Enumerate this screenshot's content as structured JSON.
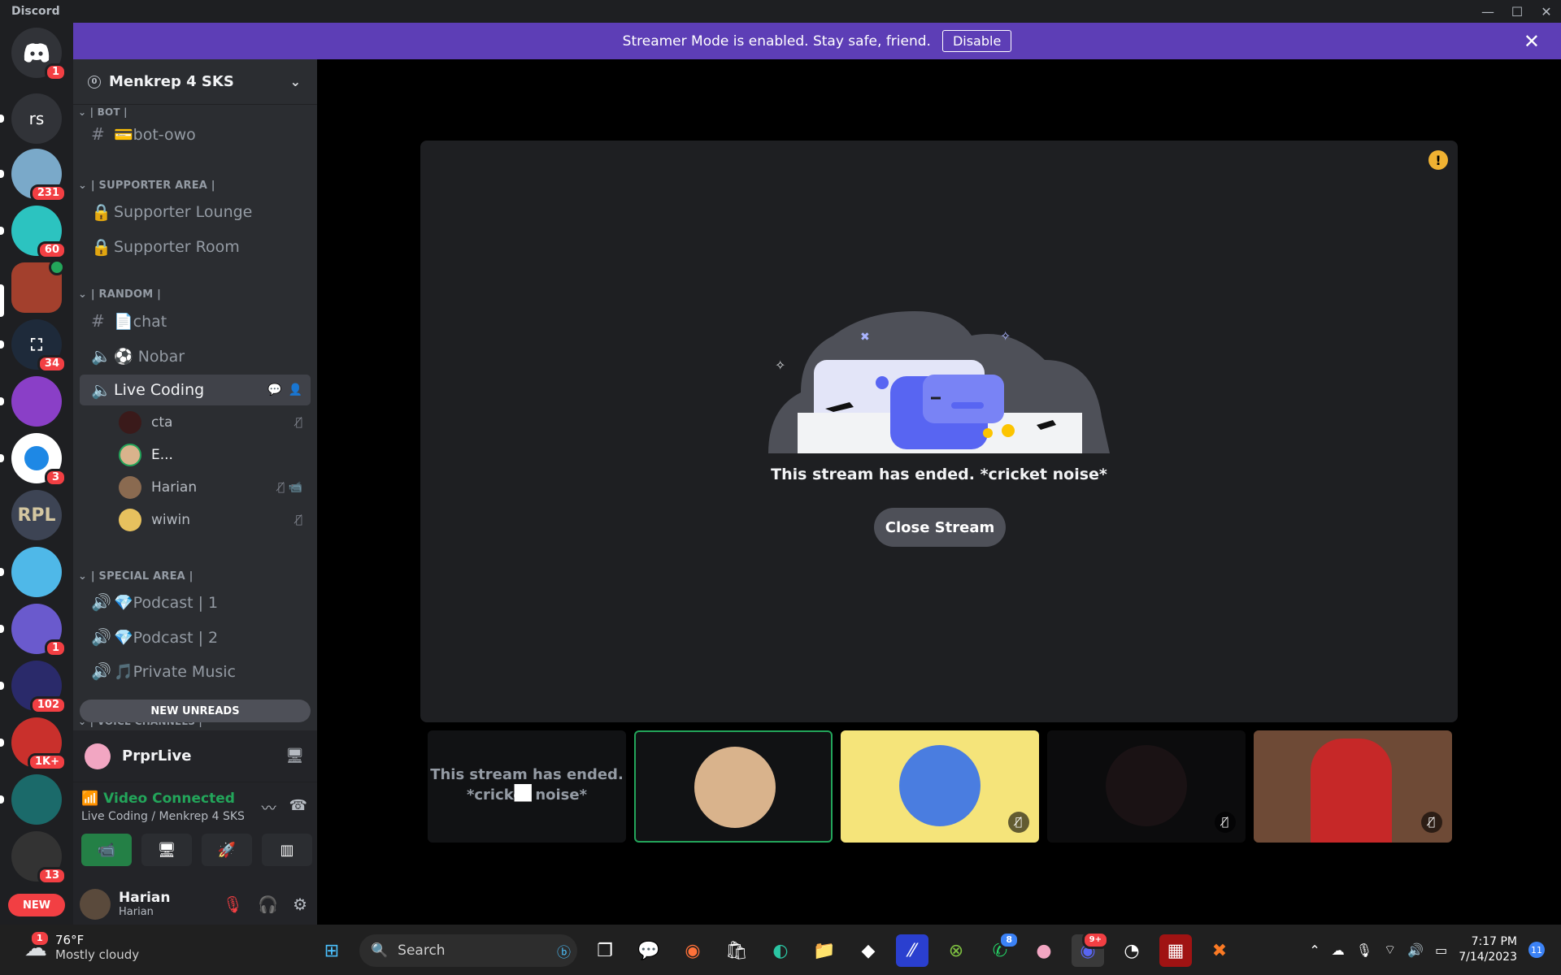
{
  "window": {
    "app_title": "Discord"
  },
  "servers": {
    "home_badge": "1",
    "rs_label": "rs",
    "badges": [
      "231",
      "60",
      "34",
      "3",
      "1",
      "102",
      "1K+",
      "13"
    ],
    "rpl_label": "RPL",
    "new_label": "NEW"
  },
  "banner": {
    "message": "Streamer Mode is enabled. Stay safe, friend.",
    "disable_label": "Disable"
  },
  "guild": {
    "name": "Menkrep 4 SKS"
  },
  "categories": {
    "bot": "| BOT |",
    "supporter": "| SUPPORTER AREA |",
    "random": "| RANDOM |",
    "special": "| SPECIAL AREA |",
    "voice": "| VOICE CHANNELS |"
  },
  "channels": {
    "bot_owo": "💳bot-owo",
    "supporter_lounge": "Supporter Lounge",
    "supporter_room": "Supporter Room",
    "chat": "📄chat",
    "nobar": "⚽ Nobar",
    "live_coding": "Live Coding",
    "podcast1": "💎Podcast | 1",
    "podcast2": "💎Podcast | 2",
    "private_music": "🎵Private Music"
  },
  "voice_users": [
    "cta",
    "E...",
    "Harian",
    "wiwin"
  ],
  "new_unreads": "NEW UNREADS",
  "stream_user": {
    "name": "PrprLive"
  },
  "voice_panel": {
    "status": "Video Connected",
    "location": "Live Coding / Menkrep 4 SKS"
  },
  "account": {
    "display_name": "Harian",
    "username": "Harian"
  },
  "stage": {
    "ended_text": "This stream has ended. *cricket noise*",
    "close_label": "Close Stream"
  },
  "tiles": {
    "ended_tile_text": "This stream has ended. *cricket noise*"
  },
  "taskbar": {
    "weather_badge": "1",
    "temperature": "76°F",
    "weather_desc": "Mostly cloudy",
    "search_placeholder": "Search",
    "whatsapp_badge": "8",
    "discord_badge": "9+",
    "time": "7:17 PM",
    "date": "7/14/2023",
    "notif_count": "11"
  },
  "colors": {
    "accent": "#5865f2",
    "banner": "#5d3eb6",
    "green": "#23a55a",
    "red": "#f23f43"
  }
}
